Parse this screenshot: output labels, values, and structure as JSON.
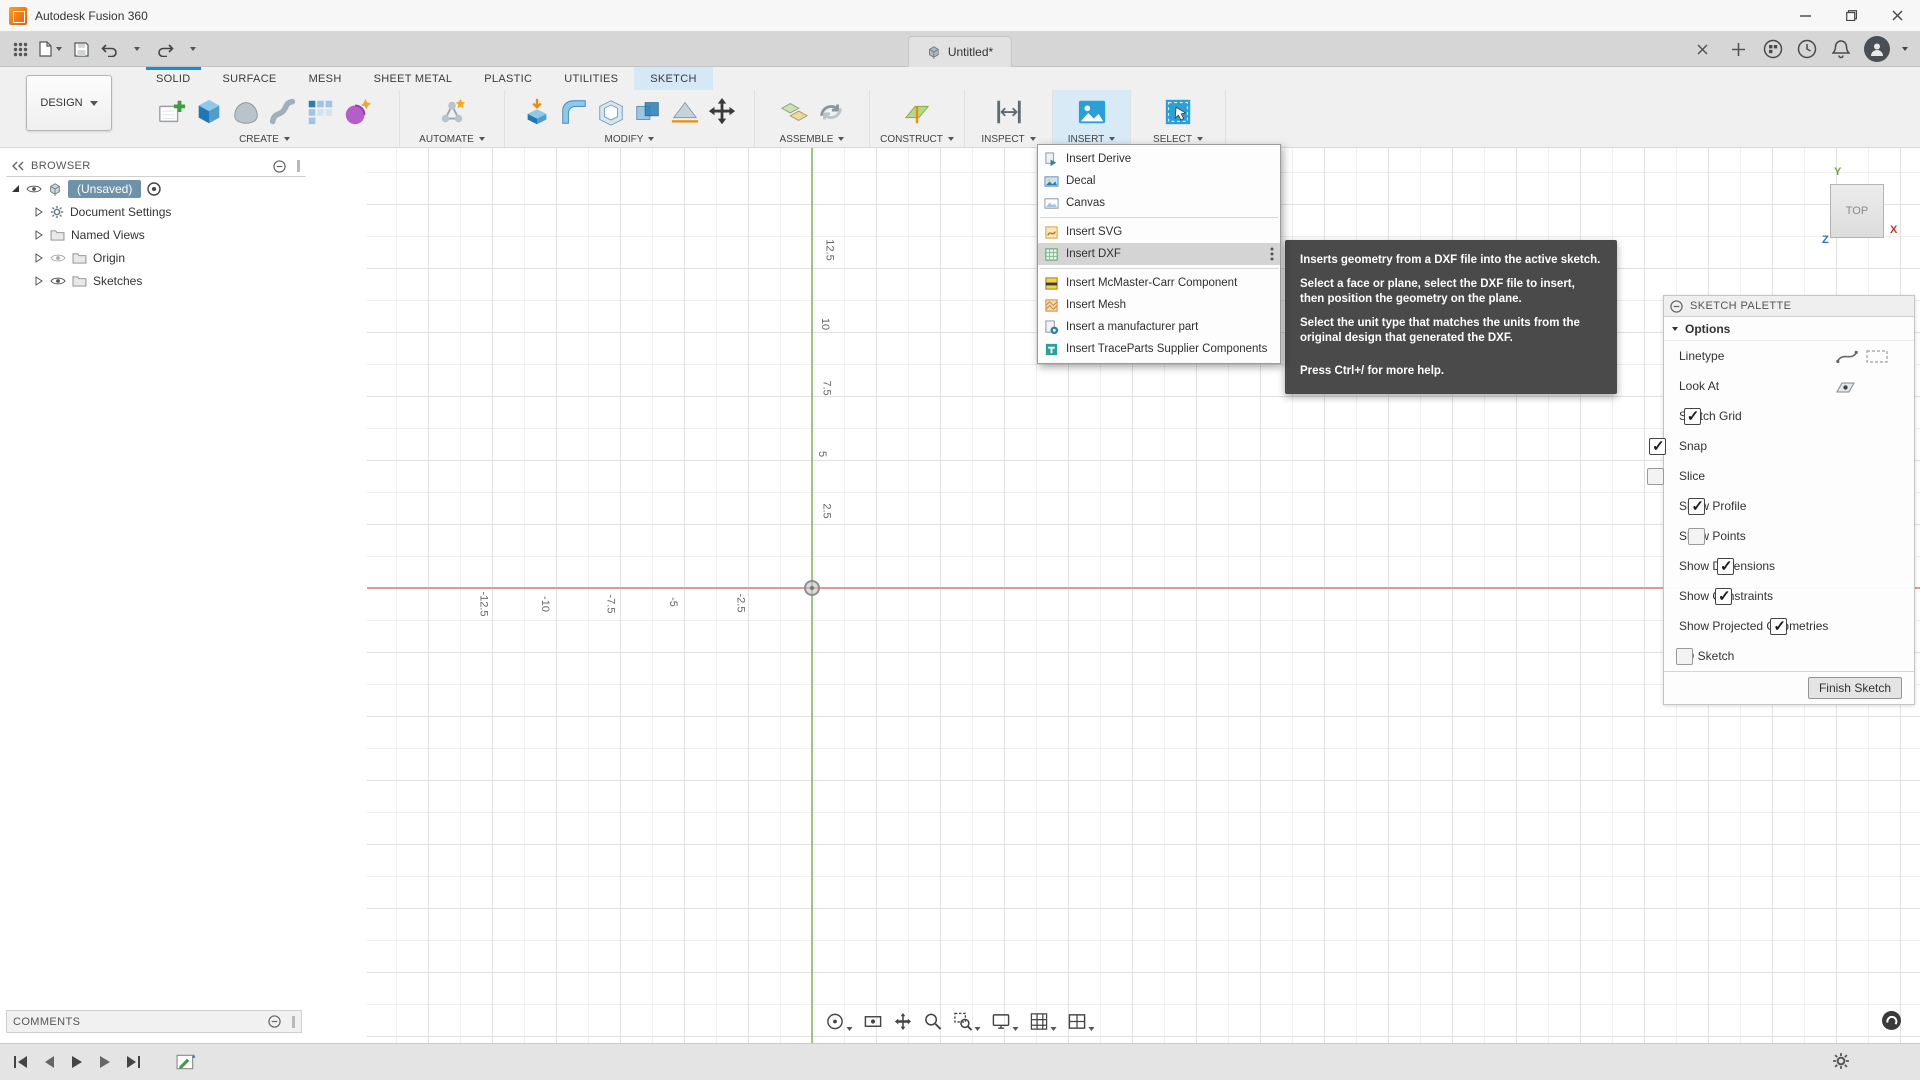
{
  "window": {
    "app_title": "Autodesk Fusion 360"
  },
  "doc_tab": {
    "label": "Untitled*"
  },
  "ribbon": {
    "design_label": "DESIGN",
    "tabs": [
      "SOLID",
      "SURFACE",
      "MESH",
      "SHEET METAL",
      "PLASTIC",
      "UTILITIES",
      "SKETCH"
    ],
    "active_tab": "SKETCH",
    "groups": [
      {
        "label": "CREATE"
      },
      {
        "label": "AUTOMATE"
      },
      {
        "label": "MODIFY"
      },
      {
        "label": "ASSEMBLE"
      },
      {
        "label": "CONSTRUCT"
      },
      {
        "label": "INSPECT"
      },
      {
        "label": "INSERT",
        "highlighted": true
      },
      {
        "label": "SELECT"
      }
    ]
  },
  "insert_menu": {
    "items": [
      {
        "label": "Insert Derive",
        "icon": "insert-derive-icon"
      },
      {
        "label": "Decal",
        "icon": "decal-icon"
      },
      {
        "label": "Canvas",
        "icon": "canvas-icon"
      },
      {
        "label": "Insert SVG",
        "icon": "insert-svg-icon"
      },
      {
        "label": "Insert DXF",
        "icon": "insert-dxf-icon",
        "highlighted": true
      },
      {
        "label": "Insert McMaster-Carr Component",
        "icon": "mcmaster-icon"
      },
      {
        "label": "Insert Mesh",
        "icon": "insert-mesh-icon"
      },
      {
        "label": "Insert a manufacturer part",
        "icon": "manufacturer-part-icon"
      },
      {
        "label": "Insert TraceParts Supplier Components",
        "icon": "traceparts-icon"
      }
    ]
  },
  "tooltip": {
    "paragraphs": [
      "Inserts geometry from a DXF file into the active sketch.",
      "Select a face or plane, select the DXF file to insert, then position the geometry on the plane.",
      "Select the unit type that matches the units from the original design that generated the DXF.",
      "Press Ctrl+/ for more help."
    ]
  },
  "browser": {
    "title": "BROWSER",
    "root_label": "(Unsaved)",
    "items": [
      "Document Settings",
      "Named Views",
      "Origin",
      "Sketches"
    ]
  },
  "viewcube": {
    "face": "TOP",
    "axis_x": "X",
    "axis_y": "Y",
    "axis_z": "Z"
  },
  "palette": {
    "title": "SKETCH PALETTE",
    "section_label": "Options",
    "rows": [
      {
        "label": "Linetype",
        "control": "icons"
      },
      {
        "label": "Look At",
        "control": "icon"
      },
      {
        "label": "Sketch Grid",
        "checked": true
      },
      {
        "label": "Snap",
        "checked": true
      },
      {
        "label": "Slice",
        "checked": false
      },
      {
        "label": "Show Profile",
        "checked": true
      },
      {
        "label": "Show Points",
        "checked": false
      },
      {
        "label": "Show Dimensions",
        "checked": true
      },
      {
        "label": "Show Constraints",
        "checked": true
      },
      {
        "label": "Show Projected Geometries",
        "checked": true
      },
      {
        "label": "3D Sketch",
        "checked": false
      }
    ],
    "finish_label": "Finish Sketch"
  },
  "canvas": {
    "y_labels": [
      "12.5",
      "10",
      "7.5",
      "5",
      "2.5"
    ],
    "x_labels": [
      "-12.5",
      "-10",
      "-7.5",
      "-5",
      "-2.5"
    ]
  },
  "comments": {
    "title": "COMMENTS"
  },
  "colors": {
    "accent_blue": "#0696d7",
    "tooltip_bg": "#4a4a4a",
    "axis_green": "#8cbd76",
    "axis_red": "#dd8a8a",
    "selection_chip": "#6f92ab"
  }
}
